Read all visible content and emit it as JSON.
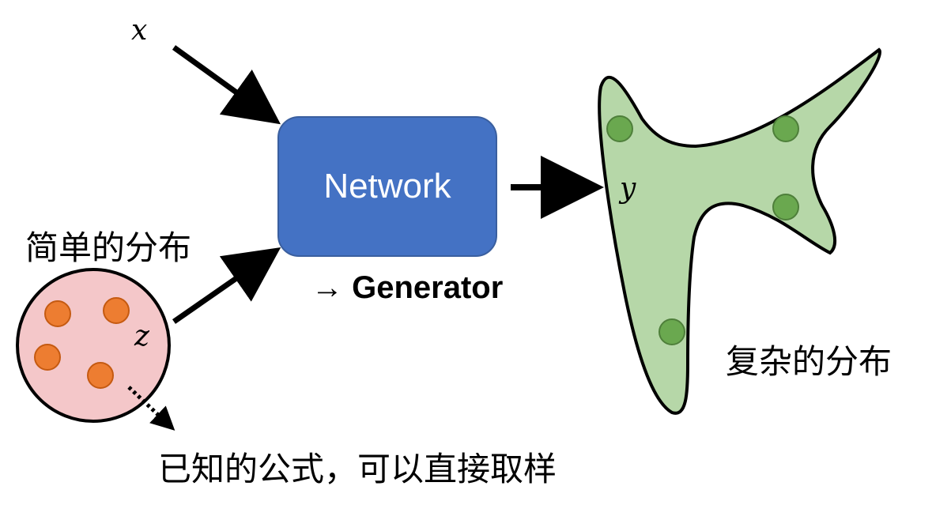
{
  "labels": {
    "x_var": "x",
    "z_var": "z",
    "y_var": "y",
    "network": "Network",
    "generator_arrow": "→",
    "generator": "Generator",
    "simple_distribution": "简单的分布",
    "complex_distribution": "复杂的分布",
    "sampling_note": "已知的公式，可以直接取样"
  },
  "colors": {
    "network_fill": "#4472c4",
    "network_stroke": "#3a5f9f",
    "simple_fill": "#f4c7c9",
    "simple_dots": "#ed7d31",
    "complex_fill": "#b6d7a8",
    "complex_dots": "#6aa84f",
    "arrow": "#000000"
  }
}
